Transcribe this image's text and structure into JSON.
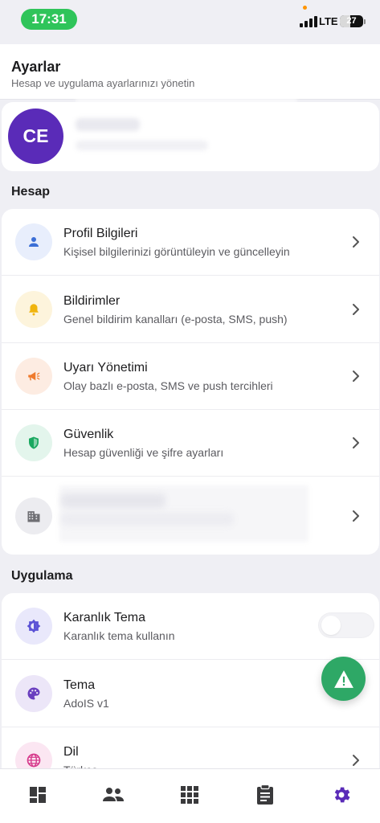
{
  "status_bar": {
    "time": "17:31",
    "network": "LTE",
    "battery": "27"
  },
  "header": {
    "title": "Ayarlar",
    "subtitle": "Hesap ve uygulama ayarlarınızı yönetin"
  },
  "user": {
    "initials": "CE",
    "avatar_color": "#5a2bb8"
  },
  "sections": {
    "account_title": "Hesap",
    "app_title": "Uygulama"
  },
  "account_items": [
    {
      "icon": "person-icon",
      "title": "Profil Bilgileri",
      "subtitle": "Kişisel bilgilerinizi görüntüleyin ve güncelleyin",
      "icon_bg": "#e8eefc",
      "icon_color": "#3c6fd6"
    },
    {
      "icon": "bell-icon",
      "title": "Bildirimler",
      "subtitle": "Genel bildirim kanalları (e-posta, SMS, push)",
      "icon_bg": "#fdf4dc",
      "icon_color": "#f0b40e"
    },
    {
      "icon": "megaphone-icon",
      "title": "Uyarı Yönetimi",
      "subtitle": "Olay bazlı e-posta, SMS ve push tercihleri",
      "icon_bg": "#fdece2",
      "icon_color": "#ef7a2c"
    },
    {
      "icon": "shield-icon",
      "title": "Güvenlik",
      "subtitle": "Hesap güvenliği ve şifre ayarları",
      "icon_bg": "#e3f5ec",
      "icon_color": "#1aa860"
    },
    {
      "icon": "building-icon",
      "title": "",
      "subtitle": "",
      "icon_bg": "#ececf0",
      "icon_color": "#6f6f74"
    }
  ],
  "app_items": [
    {
      "icon": "brightness-icon",
      "title": "Karanlık Tema",
      "subtitle": "Karanlık tema kullanın",
      "icon_bg": "#e9e8fb",
      "icon_color": "#5b52d6",
      "toggle": false
    },
    {
      "icon": "palette-icon",
      "title": "Tema",
      "subtitle": "AdoIS v1",
      "icon_bg": "#ece6f8",
      "icon_color": "#6a3fbf"
    },
    {
      "icon": "globe-icon",
      "title": "Dil",
      "subtitle": "Türkçe",
      "icon_bg": "#fbe6f2",
      "icon_color": "#d63a8c"
    }
  ],
  "fab": {
    "icon": "warning-icon",
    "color": "#2ea866"
  },
  "bottom_nav": [
    {
      "icon": "dashboard-icon",
      "active": false
    },
    {
      "icon": "people-icon",
      "active": false
    },
    {
      "icon": "apps-grid-icon",
      "active": false
    },
    {
      "icon": "clipboard-icon",
      "active": false
    },
    {
      "icon": "settings-gear-icon",
      "active": true,
      "color": "#5a2bb8"
    }
  ]
}
